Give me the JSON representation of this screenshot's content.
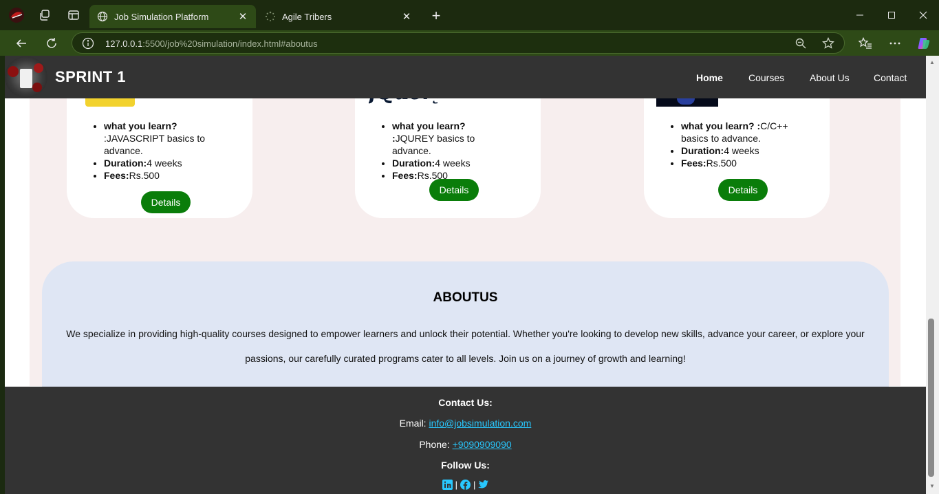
{
  "browser": {
    "tabs": [
      {
        "title": "Job Simulation Platform",
        "active": true
      },
      {
        "title": "Agile Tribers",
        "active": false
      }
    ],
    "url_host": "127.0.0.1",
    "url_rest": ":5500/job%20simulation/index.html#aboutus"
  },
  "site": {
    "brand": "SPRINT 1",
    "nav": [
      "Home",
      "Courses",
      "About Us",
      "Contact"
    ]
  },
  "courses": [
    {
      "learn_label": "what you learn?",
      "learn_value": ":JAVASCRIPT basics to advance.",
      "duration_label": "Duration:",
      "duration_value": "4 weeks",
      "fees_label": "Fees:",
      "fees_value": "Rs.500",
      "button": "Details"
    },
    {
      "learn_label": "what you learn? :",
      "learn_value": "JQUREY basics to advance.",
      "duration_label": "Duration:",
      "duration_value": "4 weeks",
      "fees_label": "Fees:",
      "fees_value": "Rs.500",
      "button": "Details",
      "logo_text": "jQuery"
    },
    {
      "learn_label": "what you learn? :",
      "learn_value": "C/C++ basics to advance.",
      "duration_label": "Duration:",
      "duration_value": "4 weeks",
      "fees_label": "Fees:",
      "fees_value": "Rs.500",
      "button": "Details"
    }
  ],
  "about": {
    "title": "ABOUTUS",
    "text": "We specialize in providing high-quality courses designed to empower learners and unlock their potential. Whether you're looking to develop new skills, advance your career, or explore your passions, our carefully curated programs cater to all levels. Join us on a journey of growth and learning!"
  },
  "footer": {
    "contact_heading": "Contact Us:",
    "email_label": "Email: ",
    "email": "info@jobsimulation.com",
    "phone_label": "Phone: ",
    "phone": "+9090909090",
    "follow_heading": "Follow Us:",
    "separator": "|",
    "social_icons": [
      "linkedin-icon",
      "facebook-icon",
      "twitter-icon"
    ]
  },
  "colors": {
    "navbar": "#333333",
    "details_button": "#0a7d0a",
    "about_bg": "#dfe6f4",
    "link": "#28c8ff"
  }
}
